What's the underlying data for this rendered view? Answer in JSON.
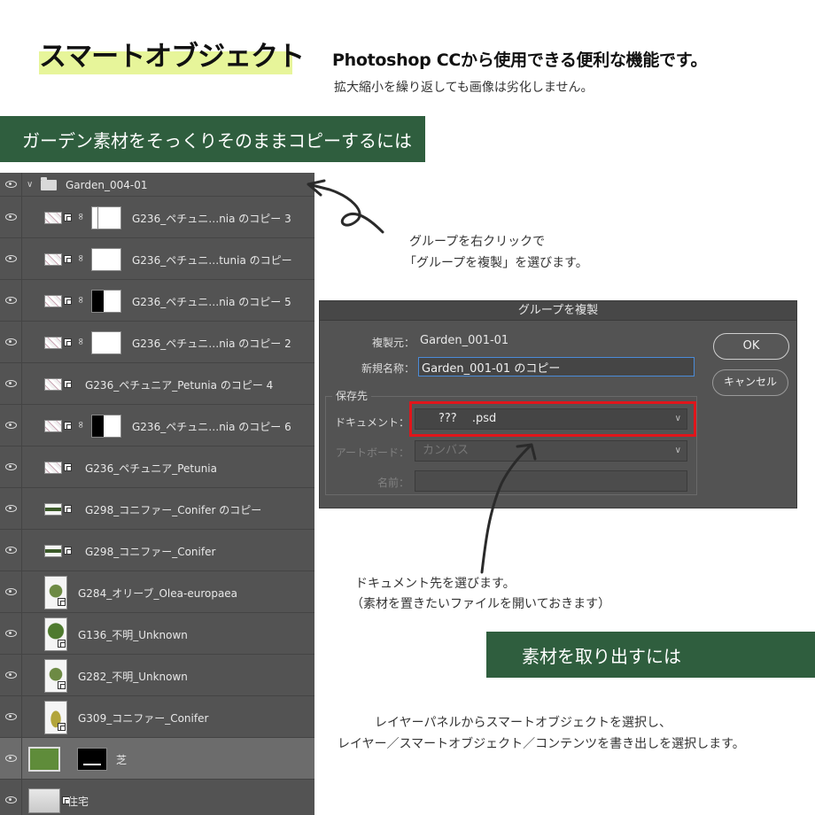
{
  "header": {
    "title": "スマートオブジェクト",
    "subtitle": "Photoshop CCから使用できる便利な機能です。",
    "note": "拡大縮小を繰り返しても画像は劣化しません。"
  },
  "banners": {
    "top": "ガーデン素材をそっくりそのままコピーするには",
    "bottom": "素材を取り出すには"
  },
  "layers_panel": {
    "group": {
      "name": "Garden_004-01",
      "expanded": true
    },
    "layers": [
      {
        "name": "G236_ペチュニ…nia のコピー 3",
        "thumb": "flower",
        "mask": "partial"
      },
      {
        "name": "G236_ペチュニ…tunia のコピー",
        "thumb": "flower",
        "mask": "white"
      },
      {
        "name": "G236_ペチュニ…nia のコピー 5",
        "thumb": "flower",
        "mask": "half"
      },
      {
        "name": "G236_ペチュニ…nia のコピー 2",
        "thumb": "flower",
        "mask": "white"
      },
      {
        "name": "G236_ペチュニア_Petunia のコピー 4",
        "thumb": "flower",
        "mask": ""
      },
      {
        "name": "G236_ペチュニ…nia のコピー 6",
        "thumb": "flower",
        "mask": "half"
      },
      {
        "name": "G236_ペチュニア_Petunia",
        "thumb": "flower",
        "mask": ""
      },
      {
        "name": "G298_コニファー_Conifer のコピー",
        "thumb": "hedge",
        "mask": ""
      },
      {
        "name": "G298_コニファー_Conifer",
        "thumb": "hedge",
        "mask": ""
      },
      {
        "name": "G284_オリーブ_Olea-europaea",
        "thumb": "tree2",
        "mask": ""
      },
      {
        "name": "G136_不明_Unknown",
        "thumb": "tree",
        "mask": ""
      },
      {
        "name": "G282_不明_Unknown",
        "thumb": "tree2",
        "mask": ""
      },
      {
        "name": "G309_コニファー_Conifer",
        "thumb": "cone",
        "mask": ""
      },
      {
        "name": "芝",
        "thumb": "lawn",
        "mask": "dark",
        "selected": true
      },
      {
        "name": "住宅",
        "thumb": "house",
        "mask": ""
      }
    ]
  },
  "annotations": {
    "right_click_line1": "グループを右クリックで",
    "right_click_line2": "「グループを複製」を選びます。",
    "doc_line1": "ドキュメント先を選びます。",
    "doc_line2": "（素材を置きたいファイルを開いておきます）",
    "export_line1": "レイヤーパネルからスマートオブジェクトを選択し、",
    "export_line2": "レイヤー／スマートオブジェクト／コンテンツを書き出しを選択します。"
  },
  "dialog": {
    "title": "グループを複製",
    "source_label": "複製元：",
    "source_value": "Garden_001-01",
    "new_name_label": "新規名称：",
    "new_name_value": "Garden_001-01 のコピー",
    "destination_label": "保存先",
    "document_label": "ドキュメント：",
    "document_value": "???　   .psd",
    "artboard_label": "アートボード：",
    "artboard_value": "カンバス",
    "name_label": "名前：",
    "name_value": "",
    "ok_label": "OK",
    "cancel_label": "キャンセル"
  },
  "colors": {
    "banner_green": "#2f5e3e",
    "title_highlight": "#e7f59a",
    "panel_bg": "#535353",
    "highlight_red": "#e0151b",
    "focus_blue": "#4a8bd8"
  }
}
